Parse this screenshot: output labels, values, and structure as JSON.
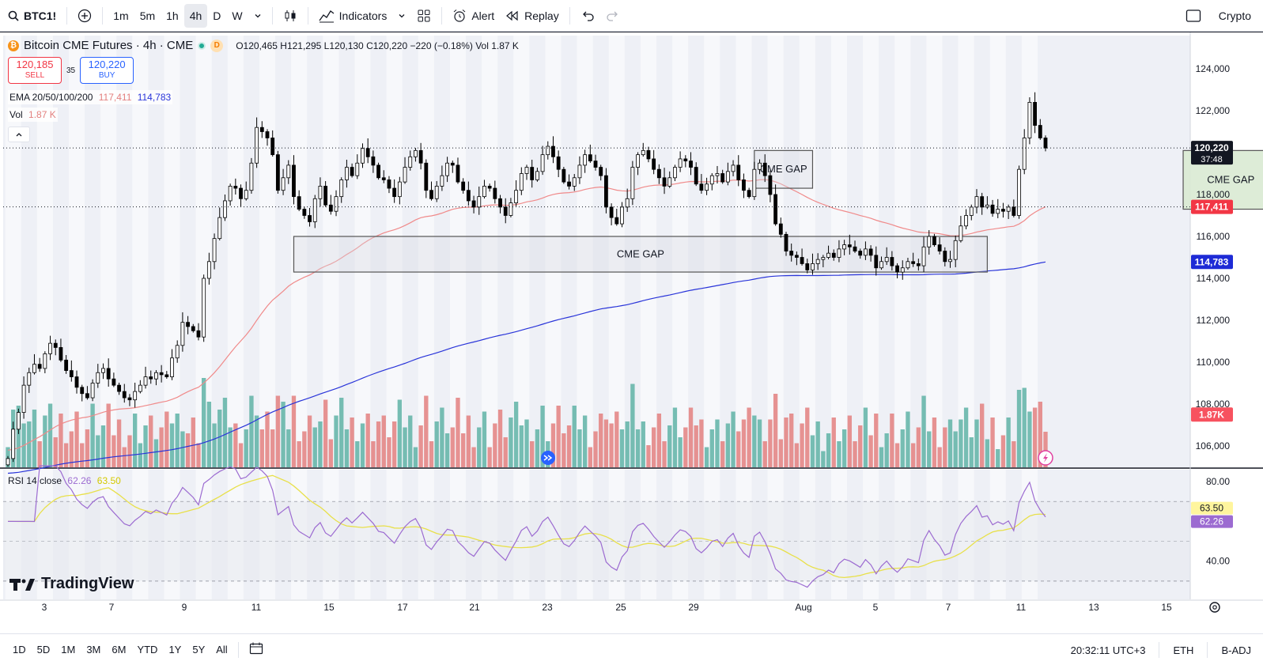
{
  "toolbar": {
    "symbol": "BTC1!",
    "intervals": [
      "1m",
      "5m",
      "1h",
      "4h",
      "D",
      "W"
    ],
    "active_interval": "4h",
    "indicators_label": "Indicators",
    "alert_label": "Alert",
    "replay_label": "Replay",
    "market_label": "Crypto"
  },
  "legend": {
    "title": "Bitcoin CME Futures · 4h · CME",
    "badge": "D",
    "open": "O120,465",
    "high": "H121,295",
    "low": "L120,130",
    "close": "C120,220",
    "change": "−220 (−0.18%)",
    "volume": "Vol 1.87 K",
    "sell_price": "120,185",
    "sell_label": "SELL",
    "spread": "35",
    "buy_price": "120,220",
    "buy_label": "BUY",
    "ema_label": "EMA 20/50/100/200",
    "ema_v1": "117,411",
    "ema_v2": "114,783",
    "vol_label": "Vol",
    "vol_value": "1.87 K"
  },
  "rsi_legend": {
    "label": "RSI 14 close",
    "rsi": "62.26",
    "ma": "63.50"
  },
  "annotations": [
    "CME GAP",
    "CME GAP",
    "CME GAP"
  ],
  "price_axis": {
    "ticks": [
      "124,000",
      "122,000",
      "120,000",
      "118,000",
      "116,000",
      "114,000",
      "112,000",
      "110,000",
      "108,000",
      "106,000"
    ],
    "last_price": "120,220",
    "countdown": "37:48",
    "ema_red_tag": "117,411",
    "ema_blue_tag": "114,783",
    "vol_tag": "1.87K"
  },
  "rsi_axis": {
    "ticks": [
      "80.00",
      "40.00"
    ],
    "ma_tag": "63.50",
    "rsi_tag": "62.26"
  },
  "time_axis": [
    "3",
    "7",
    "9",
    "11",
    "15",
    "17",
    "21",
    "23",
    "25",
    "29",
    "Aug",
    "5",
    "7",
    "11",
    "13",
    "15"
  ],
  "bottombar": {
    "ranges": [
      "1D",
      "5D",
      "1M",
      "3M",
      "6M",
      "YTD",
      "1Y",
      "5Y",
      "All"
    ],
    "time": "20:32:11 UTC+3",
    "session": "ETH",
    "adjust": "B-ADJ"
  },
  "watermark": "TradingView",
  "colors": {
    "up": "#ffffff",
    "down": "#000000",
    "ema_red": "#f08a8a",
    "ema_blue": "#2934d9",
    "vol_up": "#5fb3a6",
    "vol_down": "#e3807f",
    "rsi": "#9c6bd1",
    "rsi_ma": "#e8e04a",
    "gap_fill": "#d9ead3"
  },
  "chart_data": {
    "type": "candlestick",
    "interval": "4h",
    "ylim": [
      105000,
      124800
    ],
    "closes": [
      105400,
      106800,
      107600,
      108900,
      109500,
      109900,
      109700,
      110400,
      110900,
      110700,
      110100,
      109600,
      109300,
      108800,
      108500,
      108300,
      109000,
      109500,
      109700,
      109200,
      108900,
      108600,
      108300,
      108200,
      108600,
      108900,
      109300,
      109200,
      109500,
      109400,
      109300,
      110200,
      110800,
      111900,
      111700,
      111500,
      111200,
      114000,
      114800,
      115900,
      116900,
      117700,
      118400,
      118300,
      117800,
      118200,
      119500,
      121200,
      121000,
      120700,
      119900,
      118200,
      118800,
      119400,
      117900,
      117300,
      117000,
      116700,
      117800,
      118400,
      117500,
      117200,
      117900,
      118700,
      119300,
      118900,
      119500,
      120200,
      119800,
      119400,
      118800,
      118700,
      118300,
      117900,
      118600,
      119300,
      119800,
      120100,
      119500,
      118200,
      117800,
      118400,
      118900,
      119500,
      119400,
      118600,
      118200,
      117700,
      117400,
      117900,
      118400,
      118300,
      117800,
      117400,
      117000,
      117600,
      118200,
      119000,
      119300,
      118700,
      119100,
      119900,
      120300,
      119800,
      119200,
      118600,
      118400,
      118800,
      119400,
      119900,
      119600,
      119300,
      118900,
      117400,
      116900,
      116600,
      117400,
      117800,
      119300,
      119900,
      120100,
      119700,
      119200,
      118800,
      118400,
      118800,
      119300,
      119700,
      119600,
      119300,
      118500,
      118200,
      118500,
      118900,
      119000,
      118600,
      119100,
      119400,
      118700,
      118200,
      117900,
      119200,
      119500,
      118900,
      118000,
      116600,
      116100,
      115300,
      115100,
      115000,
      114700,
      114400,
      114700,
      114900,
      115000,
      115200,
      115000,
      115400,
      115600,
      115500,
      115300,
      115100,
      115400,
      115100,
      114500,
      114800,
      115000,
      114600,
      114300,
      114500,
      114800,
      114700,
      114600,
      115500,
      116000,
      115600,
      115300,
      114800,
      114900,
      115800,
      116500,
      117000,
      117400,
      117900,
      117400,
      117500,
      117100,
      117300,
      117200,
      117400,
      117000,
      119200,
      120700,
      122400,
      121300,
      120700,
      120220
    ],
    "ema_red_last": 117411,
    "ema_blue_last": 114783,
    "rsi_last": 62.26,
    "rsi_ma_last": 63.5,
    "rsi_levels": [
      70,
      50,
      30
    ],
    "gaps": [
      {
        "label": "CME GAP",
        "from_bar": 54,
        "to_bar": 185,
        "low": 114300,
        "high": 116000
      },
      {
        "label": "CME GAP",
        "from_bar": 141,
        "to_bar": 152,
        "low": 118300,
        "high": 120100
      },
      {
        "label": "CME GAP",
        "from_bar": 222,
        "to_bar": 240,
        "low": 117300,
        "high": 120100
      }
    ]
  }
}
